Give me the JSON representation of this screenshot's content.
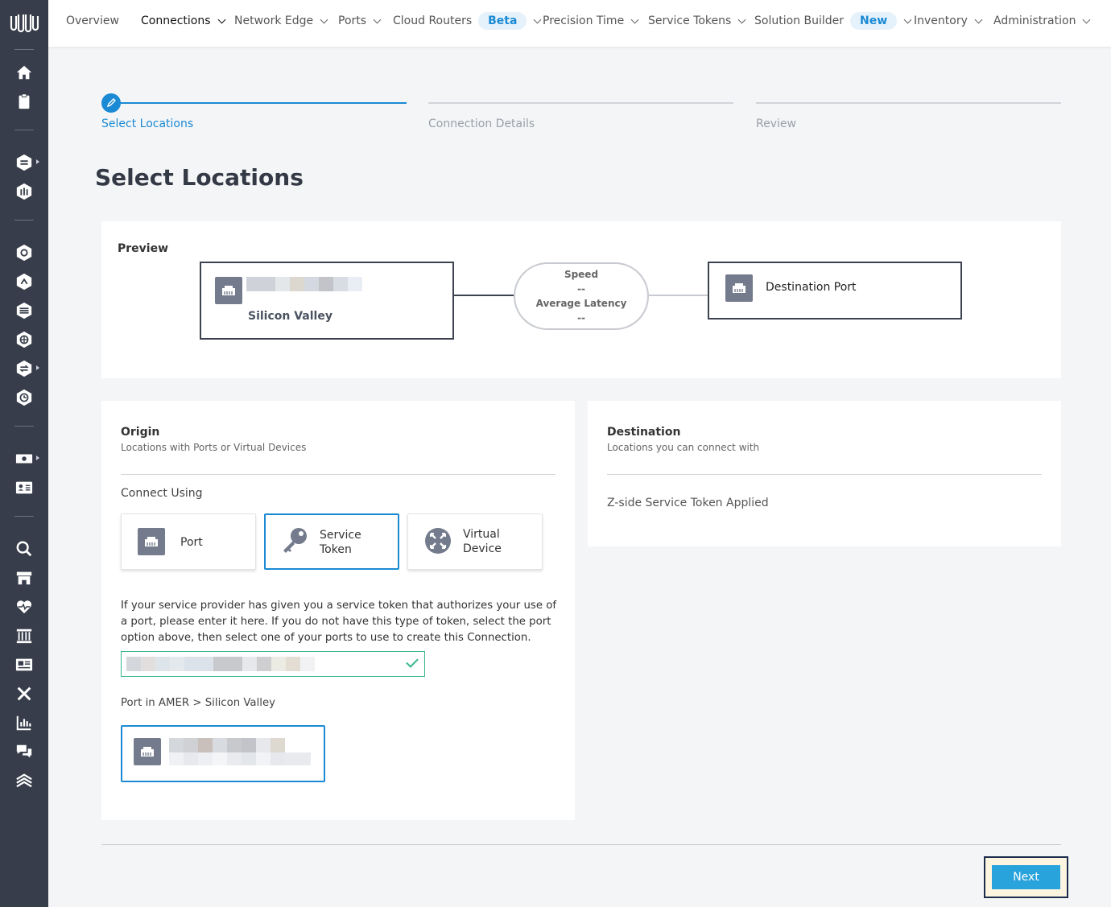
{
  "nav": {
    "items": [
      {
        "label": "Overview",
        "chevron": false,
        "active": false
      },
      {
        "label": "Connections",
        "chevron": true,
        "active": true
      },
      {
        "label": "Network Edge",
        "chevron": true,
        "active": false
      },
      {
        "label": "Ports",
        "chevron": true,
        "active": false
      },
      {
        "label": "Cloud Routers",
        "chevron": true,
        "active": false,
        "pill": "Beta"
      },
      {
        "label": "Precision Time",
        "chevron": true,
        "active": false
      },
      {
        "label": "Service Tokens",
        "chevron": true,
        "active": false
      },
      {
        "label": "Solution Builder",
        "chevron": true,
        "active": false,
        "pill": "New"
      },
      {
        "label": "Inventory",
        "chevron": true,
        "active": false
      },
      {
        "label": "Administration",
        "chevron": true,
        "active": false
      }
    ]
  },
  "stepper": {
    "steps": [
      {
        "label": "Select Locations",
        "active": true
      },
      {
        "label": "Connection Details",
        "active": false
      },
      {
        "label": "Review",
        "active": false
      }
    ]
  },
  "page_title": "Select Locations",
  "preview": {
    "label": "Preview",
    "origin_location": "Silicon Valley",
    "speed_label": "Speed",
    "speed_value": "--",
    "latency_label": "Average Latency",
    "latency_value": "--",
    "destination_label": "Destination Port"
  },
  "origin": {
    "title": "Origin",
    "subtitle": "Locations with Ports or Virtual Devices",
    "connect_using": "Connect Using",
    "options": [
      {
        "line1": "Port",
        "line2": "",
        "selected": false
      },
      {
        "line1": "Service",
        "line2": "Token",
        "selected": true
      },
      {
        "line1": "Virtual",
        "line2": "Device",
        "selected": false
      }
    ],
    "help_text": "If your service provider has given you a service token that authorizes your use of a port, please enter it here. If you do not have this type of token, select the port option above, then select one of your ports to use to create this Connection.",
    "port_in_label": "Port in AMER > Silicon Valley"
  },
  "destination": {
    "title": "Destination",
    "subtitle": "Locations you can connect with",
    "status": "Z-side Service Token Applied"
  },
  "footer": {
    "next_label": "Next"
  },
  "colors": {
    "accent": "#1a8ad4",
    "sidebar": "#373d4a",
    "next_button": "#29a3dc",
    "valid": "#35b58c"
  }
}
